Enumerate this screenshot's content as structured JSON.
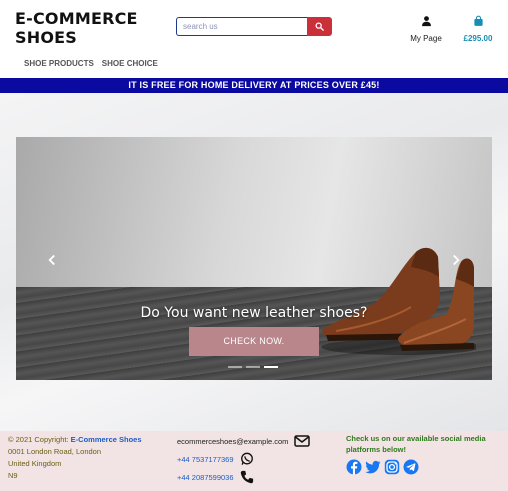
{
  "header": {
    "logo_line1": "E-COMMERCE",
    "logo_line2": "SHOES",
    "search_placeholder": "search us",
    "my_page_label": "My Page",
    "cart_total": "£295.00"
  },
  "nav": {
    "items": [
      {
        "label": "SHOE PRODUCTS"
      },
      {
        "label": "SHOE CHOICE"
      }
    ]
  },
  "banner": {
    "text": "IT IS FREE FOR HOME DELIVERY AT PRICES OVER £45!"
  },
  "carousel": {
    "caption": "Do You want new leather shoes?",
    "cta_label": "CHECK NOW.",
    "slides": 3,
    "active_slide": 3
  },
  "footer": {
    "copyright_prefix": "© 2021 Copyright:",
    "brand": "E-Commerce Shoes",
    "address_line1": "0001 London Road, London",
    "address_line2": "United Kingdom",
    "address_line3": "N9",
    "email": "ecommerceshoes@example.com",
    "phone1": "+44 7537177369",
    "phone2": "+44 2087599036",
    "social_heading": "Check us on our available social media platforms below!"
  },
  "colors": {
    "banner_bg": "#0a0aa0",
    "search_button": "#c9303a",
    "cart_accent": "#1a8db3",
    "cta_bg": "#b9868c",
    "footer_bg": "#f2e4e4",
    "social_icon": "#1877f2"
  },
  "icons": [
    "search-icon",
    "user-icon",
    "shopping-bag-icon",
    "chevron-left-icon",
    "chevron-right-icon",
    "envelope-icon",
    "whatsapp-icon",
    "phone-icon",
    "facebook-icon",
    "twitter-icon",
    "instagram-icon",
    "telegram-icon"
  ]
}
